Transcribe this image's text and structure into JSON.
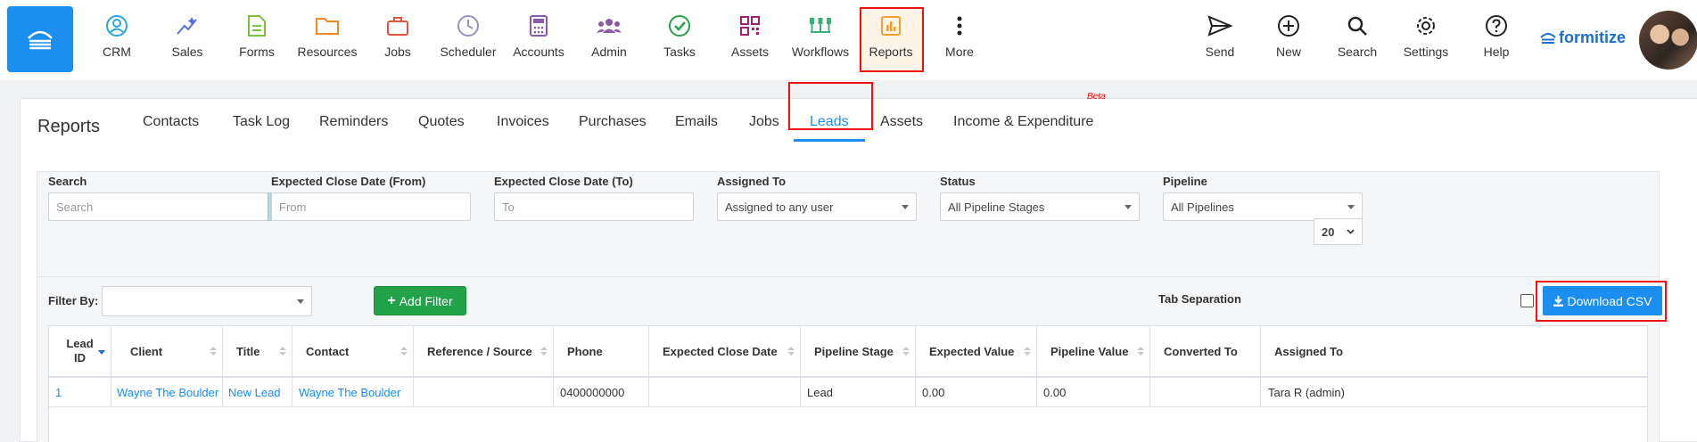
{
  "nav": {
    "items": [
      {
        "label": "CRM",
        "icon": "crm-icon",
        "color": "#2aa7d8"
      },
      {
        "label": "Sales",
        "icon": "sales-icon",
        "color": "#5a6ee0"
      },
      {
        "label": "Forms",
        "icon": "forms-icon",
        "color": "#7cc242"
      },
      {
        "label": "Resources",
        "icon": "folder-icon",
        "color": "#f08a24"
      },
      {
        "label": "Jobs",
        "icon": "briefcase-icon",
        "color": "#e0533f"
      },
      {
        "label": "Scheduler",
        "icon": "clock-icon",
        "color": "#9b8fbf"
      },
      {
        "label": "Accounts",
        "icon": "calculator-icon",
        "color": "#8a5aa8"
      },
      {
        "label": "Admin",
        "icon": "users-icon",
        "color": "#8a5aa8"
      },
      {
        "label": "Tasks",
        "icon": "check-circle-icon",
        "color": "#22a34a"
      },
      {
        "label": "Assets",
        "icon": "qr-icon",
        "color": "#a0226a"
      },
      {
        "label": "Workflows",
        "icon": "workflow-icon",
        "color": "#3cb07a"
      },
      {
        "label": "Reports",
        "icon": "chart-icon",
        "color": "#f0a030"
      },
      {
        "label": "More",
        "icon": "more-icon",
        "color": "#222222"
      }
    ],
    "right_items": [
      {
        "label": "Send",
        "icon": "send-icon"
      },
      {
        "label": "New",
        "icon": "plus-circle-icon"
      },
      {
        "label": "Search",
        "icon": "search-icon"
      },
      {
        "label": "Settings",
        "icon": "gear-icon"
      },
      {
        "label": "Help",
        "icon": "help-icon"
      }
    ],
    "brand": "formitize",
    "active_item": "Reports"
  },
  "reports": {
    "title": "Reports",
    "tabs": [
      "Contacts",
      "Task Log",
      "Reminders",
      "Quotes",
      "Invoices",
      "Purchases",
      "Emails",
      "Jobs",
      "Leads",
      "Assets",
      "Income & Expenditure"
    ],
    "active_tab": "Leads",
    "beta_label": "Beta"
  },
  "filters": {
    "search_label": "Search",
    "search_placeholder": "Search",
    "close_from_label": "Expected Close Date (From)",
    "close_from_placeholder": "From",
    "close_to_label": "Expected Close Date (To)",
    "close_to_placeholder": "To",
    "assigned_label": "Assigned To",
    "assigned_value": "Assigned to any user",
    "status_label": "Status",
    "status_value": "All Pipeline Stages",
    "pipeline_label": "Pipeline",
    "pipeline_value": "All Pipelines",
    "page_size": "20",
    "filter_by_label": "Filter By:",
    "add_filter_label": "Add Filter",
    "tab_separation_label": "Tab Separation",
    "download_csv_label": "Download CSV"
  },
  "table": {
    "columns": [
      "Lead ID",
      "Client",
      "Title",
      "Contact",
      "Reference / Source",
      "Phone",
      "Expected Close Date",
      "Pipeline Stage",
      "Expected Value",
      "Pipeline Value",
      "Converted To",
      "Assigned To"
    ],
    "rows": [
      {
        "lead_id": "1",
        "client": "Wayne The Boulder",
        "title": "New Lead",
        "contact": "Wayne The Boulder",
        "reference": "",
        "phone": "0400000000",
        "close_date": "",
        "stage": "Lead",
        "expected_value": "0.00",
        "pipeline_value": "0.00",
        "converted_to": "",
        "assigned_to": "Tara R (admin)"
      }
    ]
  },
  "colors": {
    "accent": "#1b8ef0",
    "success": "#22a34a",
    "highlight": "#ee1111"
  }
}
